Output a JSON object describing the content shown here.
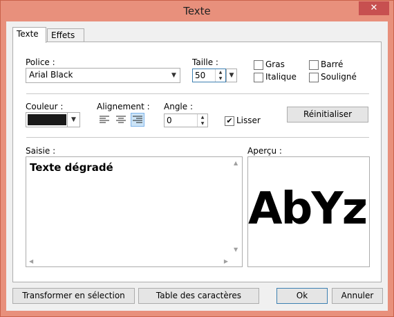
{
  "window": {
    "title": "Texte",
    "close_glyph": "✕"
  },
  "tabs": [
    {
      "label": "Texte",
      "active": true
    },
    {
      "label": "Effets",
      "active": false
    }
  ],
  "font": {
    "label": "Police :",
    "value": "Arial Black"
  },
  "size": {
    "label": "Taille :",
    "value": "50"
  },
  "styles": [
    {
      "label": "Gras",
      "checked": false
    },
    {
      "label": "Barré",
      "checked": false
    },
    {
      "label": "Italique",
      "checked": false
    },
    {
      "label": "Souligné",
      "checked": false
    }
  ],
  "color": {
    "label": "Couleur :",
    "value": "#1a1a1a"
  },
  "alignment": {
    "label": "Alignement :",
    "selected": "right"
  },
  "angle": {
    "label": "Angle :",
    "value": "0"
  },
  "smooth": {
    "label": "Lisser",
    "checked": true
  },
  "reset_label": "Réinitialiser",
  "input": {
    "label": "Saisie :",
    "text": "Texte dégradé"
  },
  "preview": {
    "label": "Aperçu :",
    "text": "AbYz"
  },
  "buttons": {
    "transform": "Transformer en sélection",
    "charmap": "Table des caractères",
    "ok": "Ok",
    "cancel": "Annuler"
  }
}
